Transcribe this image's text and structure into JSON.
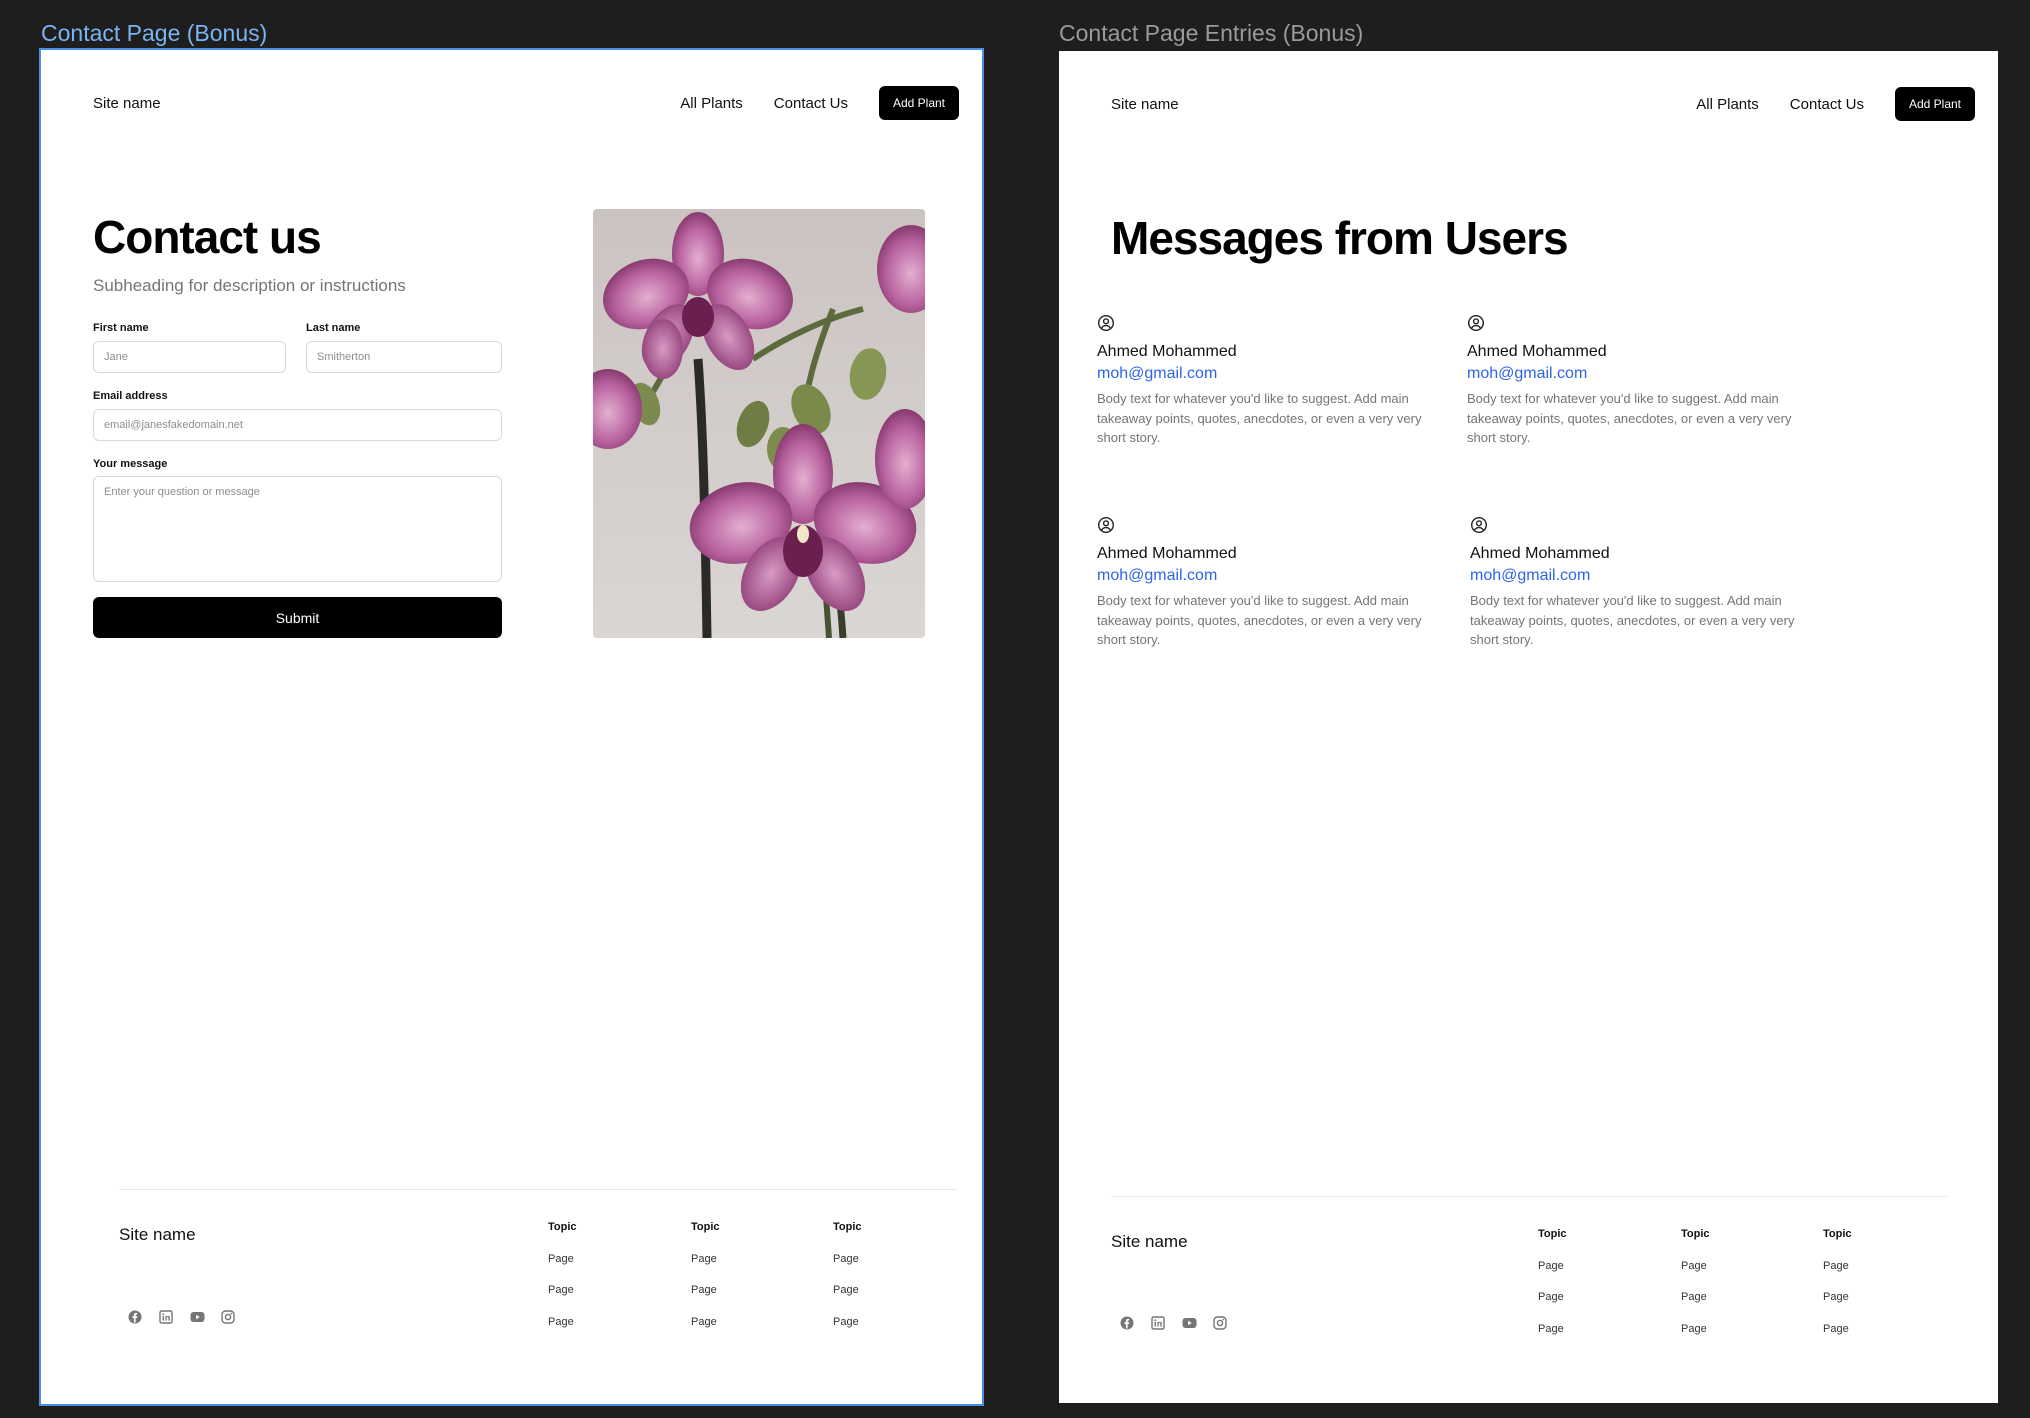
{
  "canvas": {
    "frame1_label": "Contact Page (Bonus)",
    "frame2_label": "Contact Page Entries (Bonus)"
  },
  "nav": {
    "site_name": "Site name",
    "links": [
      "All Plants",
      "Contact Us"
    ],
    "cta": "Add Plant"
  },
  "contact": {
    "title": "Contact us",
    "subheading": "Subheading for description or instructions",
    "first_name_label": "First name",
    "first_name_placeholder": "Jane",
    "last_name_label": "Last name",
    "last_name_placeholder": "Smitherton",
    "email_label": "Email address",
    "email_placeholder": "email@janesfakedomain.net",
    "message_label": "Your message",
    "message_placeholder": "Enter your question or message",
    "submit_label": "Submit"
  },
  "entries": {
    "title": "Messages from Users",
    "messages": [
      {
        "name": "Ahmed Mohammed",
        "email": "moh@gmail.com",
        "body": "Body text for whatever you'd like to suggest. Add main takeaway points, quotes, anecdotes, or even a very very short story."
      },
      {
        "name": "Ahmed Mohammed",
        "email": "moh@gmail.com",
        "body": "Body text for whatever you'd like to suggest. Add main takeaway points, quotes, anecdotes, or even a very very short story."
      },
      {
        "name": "Ahmed Mohammed",
        "email": "moh@gmail.com",
        "body": "Body text for whatever you'd like to suggest. Add main takeaway points, quotes, anecdotes, or even a very very short story."
      },
      {
        "name": "Ahmed Mohammed",
        "email": "moh@gmail.com",
        "body": "Body text for whatever you'd like to suggest. Add main takeaway points, quotes, anecdotes, or even a very very short story."
      }
    ]
  },
  "footer": {
    "site_name": "Site name",
    "columns": [
      {
        "topic": "Topic",
        "pages": [
          "Page",
          "Page",
          "Page"
        ]
      },
      {
        "topic": "Topic",
        "pages": [
          "Page",
          "Page",
          "Page"
        ]
      },
      {
        "topic": "Topic",
        "pages": [
          "Page",
          "Page",
          "Page"
        ]
      }
    ],
    "socials": [
      "facebook-icon",
      "linkedin-icon",
      "youtube-icon",
      "instagram-icon"
    ]
  },
  "colors": {
    "canvas_bg": "#1e1e1e",
    "selection": "#4a8fe7",
    "link_blue": "#2d64e8",
    "button_black": "#000000",
    "orchid": "#b5569a"
  }
}
